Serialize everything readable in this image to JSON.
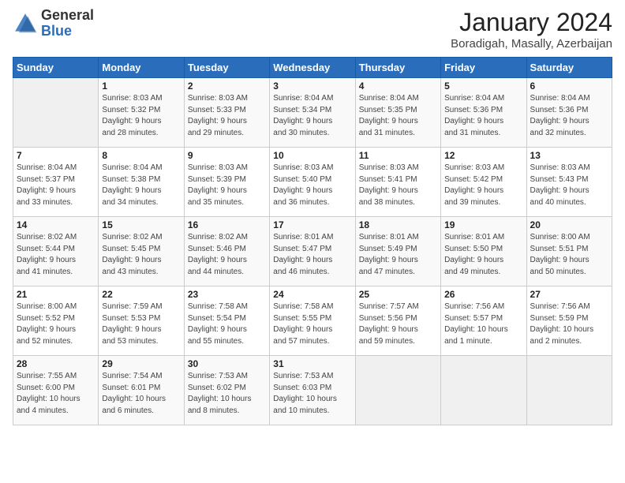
{
  "logo": {
    "general": "General",
    "blue": "Blue"
  },
  "title": "January 2024",
  "location": "Boradigah, Masally, Azerbaijan",
  "days_of_week": [
    "Sunday",
    "Monday",
    "Tuesday",
    "Wednesday",
    "Thursday",
    "Friday",
    "Saturday"
  ],
  "weeks": [
    [
      {
        "day": "",
        "info": ""
      },
      {
        "day": "1",
        "info": "Sunrise: 8:03 AM\nSunset: 5:32 PM\nDaylight: 9 hours\nand 28 minutes."
      },
      {
        "day": "2",
        "info": "Sunrise: 8:03 AM\nSunset: 5:33 PM\nDaylight: 9 hours\nand 29 minutes."
      },
      {
        "day": "3",
        "info": "Sunrise: 8:04 AM\nSunset: 5:34 PM\nDaylight: 9 hours\nand 30 minutes."
      },
      {
        "day": "4",
        "info": "Sunrise: 8:04 AM\nSunset: 5:35 PM\nDaylight: 9 hours\nand 31 minutes."
      },
      {
        "day": "5",
        "info": "Sunrise: 8:04 AM\nSunset: 5:36 PM\nDaylight: 9 hours\nand 31 minutes."
      },
      {
        "day": "6",
        "info": "Sunrise: 8:04 AM\nSunset: 5:36 PM\nDaylight: 9 hours\nand 32 minutes."
      }
    ],
    [
      {
        "day": "7",
        "info": "Sunrise: 8:04 AM\nSunset: 5:37 PM\nDaylight: 9 hours\nand 33 minutes."
      },
      {
        "day": "8",
        "info": "Sunrise: 8:04 AM\nSunset: 5:38 PM\nDaylight: 9 hours\nand 34 minutes."
      },
      {
        "day": "9",
        "info": "Sunrise: 8:03 AM\nSunset: 5:39 PM\nDaylight: 9 hours\nand 35 minutes."
      },
      {
        "day": "10",
        "info": "Sunrise: 8:03 AM\nSunset: 5:40 PM\nDaylight: 9 hours\nand 36 minutes."
      },
      {
        "day": "11",
        "info": "Sunrise: 8:03 AM\nSunset: 5:41 PM\nDaylight: 9 hours\nand 38 minutes."
      },
      {
        "day": "12",
        "info": "Sunrise: 8:03 AM\nSunset: 5:42 PM\nDaylight: 9 hours\nand 39 minutes."
      },
      {
        "day": "13",
        "info": "Sunrise: 8:03 AM\nSunset: 5:43 PM\nDaylight: 9 hours\nand 40 minutes."
      }
    ],
    [
      {
        "day": "14",
        "info": "Sunrise: 8:02 AM\nSunset: 5:44 PM\nDaylight: 9 hours\nand 41 minutes."
      },
      {
        "day": "15",
        "info": "Sunrise: 8:02 AM\nSunset: 5:45 PM\nDaylight: 9 hours\nand 43 minutes."
      },
      {
        "day": "16",
        "info": "Sunrise: 8:02 AM\nSunset: 5:46 PM\nDaylight: 9 hours\nand 44 minutes."
      },
      {
        "day": "17",
        "info": "Sunrise: 8:01 AM\nSunset: 5:47 PM\nDaylight: 9 hours\nand 46 minutes."
      },
      {
        "day": "18",
        "info": "Sunrise: 8:01 AM\nSunset: 5:49 PM\nDaylight: 9 hours\nand 47 minutes."
      },
      {
        "day": "19",
        "info": "Sunrise: 8:01 AM\nSunset: 5:50 PM\nDaylight: 9 hours\nand 49 minutes."
      },
      {
        "day": "20",
        "info": "Sunrise: 8:00 AM\nSunset: 5:51 PM\nDaylight: 9 hours\nand 50 minutes."
      }
    ],
    [
      {
        "day": "21",
        "info": "Sunrise: 8:00 AM\nSunset: 5:52 PM\nDaylight: 9 hours\nand 52 minutes."
      },
      {
        "day": "22",
        "info": "Sunrise: 7:59 AM\nSunset: 5:53 PM\nDaylight: 9 hours\nand 53 minutes."
      },
      {
        "day": "23",
        "info": "Sunrise: 7:58 AM\nSunset: 5:54 PM\nDaylight: 9 hours\nand 55 minutes."
      },
      {
        "day": "24",
        "info": "Sunrise: 7:58 AM\nSunset: 5:55 PM\nDaylight: 9 hours\nand 57 minutes."
      },
      {
        "day": "25",
        "info": "Sunrise: 7:57 AM\nSunset: 5:56 PM\nDaylight: 9 hours\nand 59 minutes."
      },
      {
        "day": "26",
        "info": "Sunrise: 7:56 AM\nSunset: 5:57 PM\nDaylight: 10 hours\nand 1 minute."
      },
      {
        "day": "27",
        "info": "Sunrise: 7:56 AM\nSunset: 5:59 PM\nDaylight: 10 hours\nand 2 minutes."
      }
    ],
    [
      {
        "day": "28",
        "info": "Sunrise: 7:55 AM\nSunset: 6:00 PM\nDaylight: 10 hours\nand 4 minutes."
      },
      {
        "day": "29",
        "info": "Sunrise: 7:54 AM\nSunset: 6:01 PM\nDaylight: 10 hours\nand 6 minutes."
      },
      {
        "day": "30",
        "info": "Sunrise: 7:53 AM\nSunset: 6:02 PM\nDaylight: 10 hours\nand 8 minutes."
      },
      {
        "day": "31",
        "info": "Sunrise: 7:53 AM\nSunset: 6:03 PM\nDaylight: 10 hours\nand 10 minutes."
      },
      {
        "day": "",
        "info": ""
      },
      {
        "day": "",
        "info": ""
      },
      {
        "day": "",
        "info": ""
      }
    ]
  ]
}
